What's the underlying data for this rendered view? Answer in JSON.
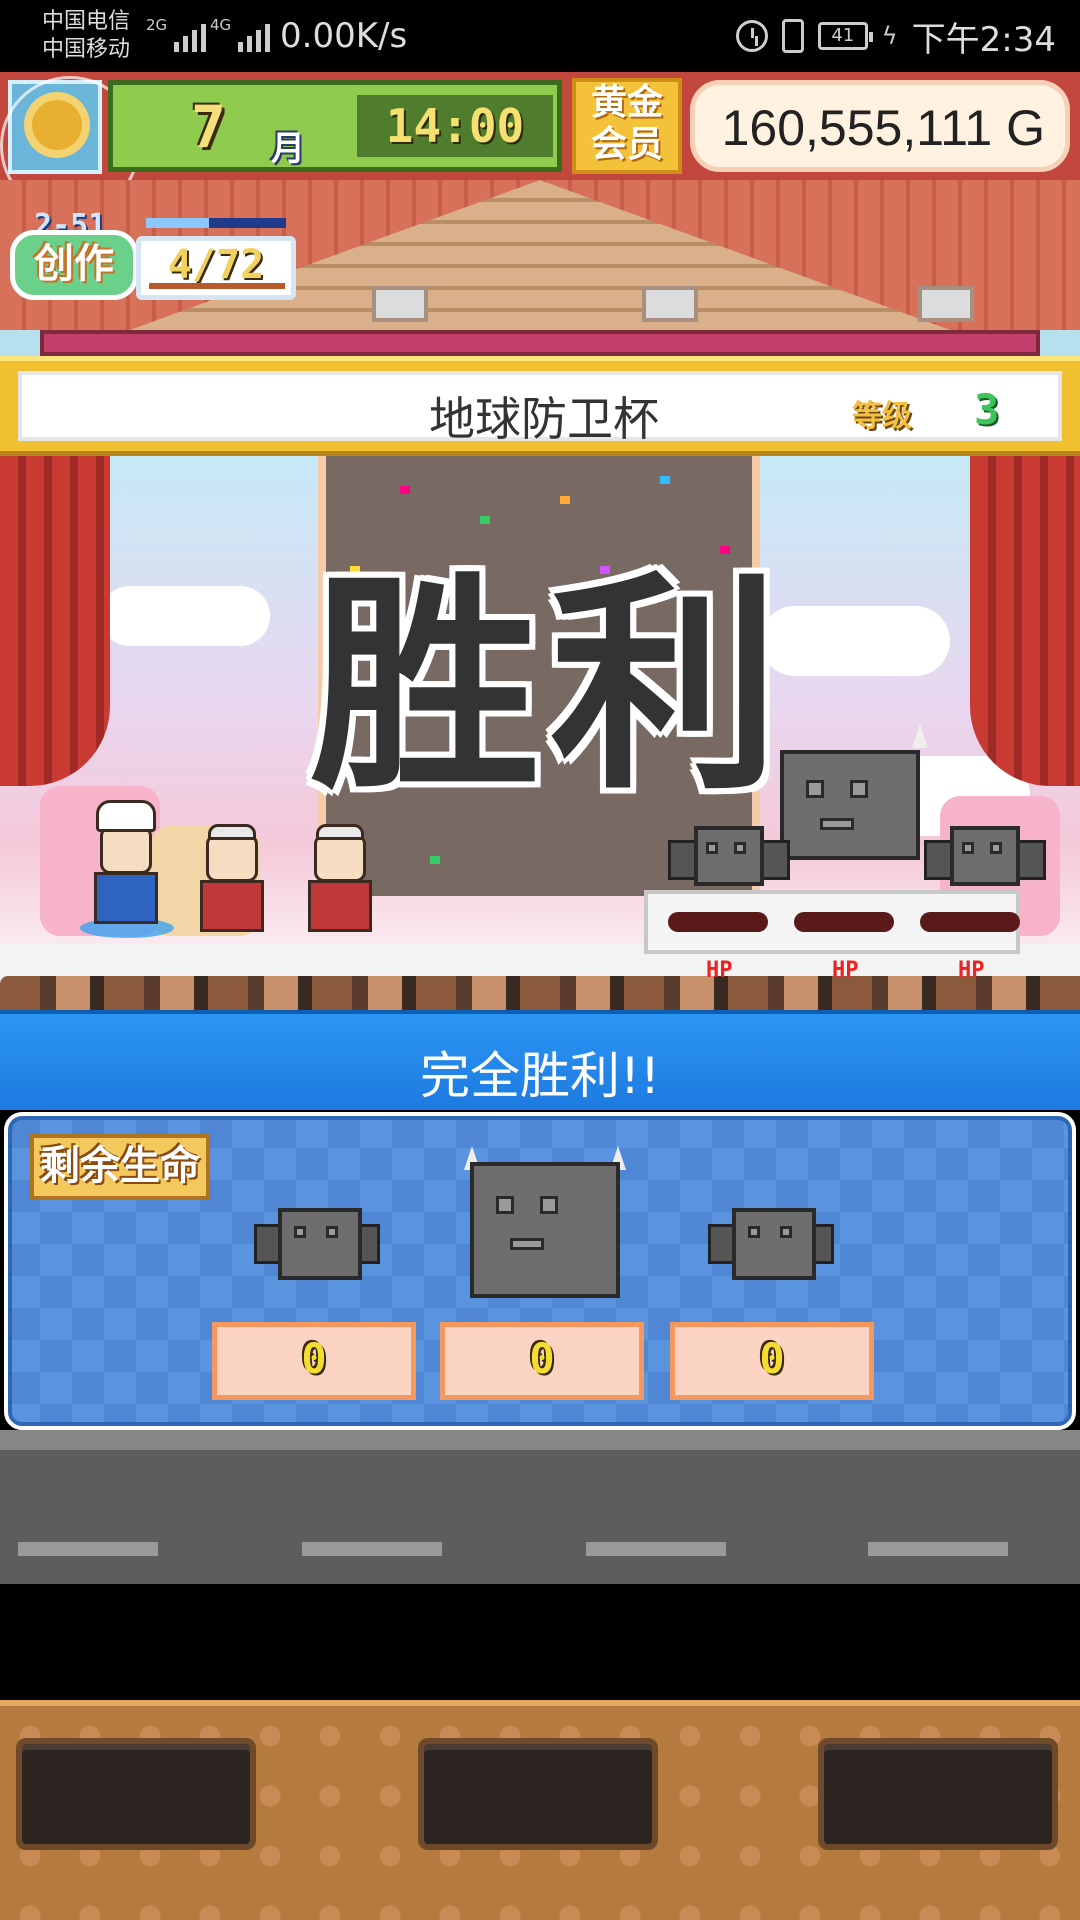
{
  "status_bar": {
    "carrier_1": "中国电信",
    "carrier_2": "中国移动",
    "net_type_1": "2G",
    "net_type_2": "4G",
    "net_speed": "0.00K/s",
    "battery": "41",
    "time": "下午2:34"
  },
  "hud": {
    "month": "7",
    "month_unit": "月",
    "time": "14:00",
    "member_badge": [
      "黄金",
      "会员"
    ],
    "money": "160,555,111 G"
  },
  "craft": {
    "level": "2-51",
    "label": "创作",
    "count": "4/72",
    "progress": 0.45
  },
  "tournament": {
    "name": "地球防卫杯",
    "rank_label": "等级",
    "rank_value": "3"
  },
  "scene": {
    "victory_text": "胜利",
    "hp_labels": [
      "HP",
      "HP",
      "HP"
    ]
  },
  "result": {
    "title": "完全胜利!!",
    "remaining_hp_label": "剩余生命",
    "enemy_hp_values": [
      "0",
      "0",
      "0"
    ]
  },
  "colors": {
    "accent_blue": "#2a96f4",
    "banner_gold": "#f0c030",
    "hud_green": "#8fcb4d",
    "wall_red": "#c2473c"
  }
}
